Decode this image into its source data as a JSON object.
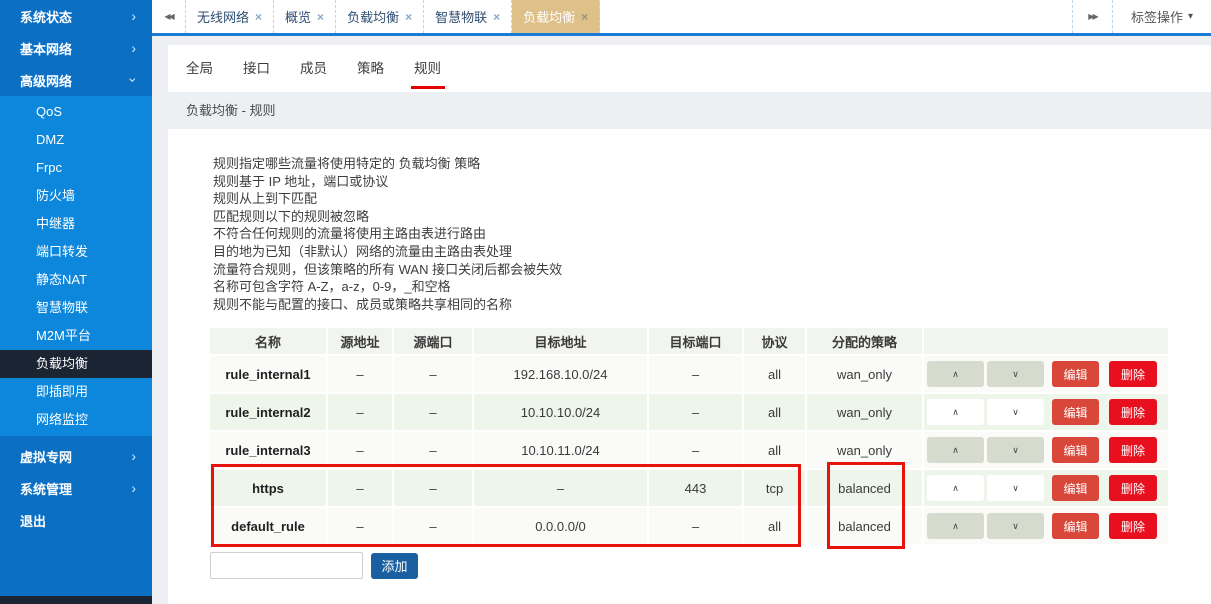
{
  "sidebar": {
    "top_items": [
      {
        "label": "系统状态",
        "expanded": false
      },
      {
        "label": "基本网络",
        "expanded": false
      },
      {
        "label": "高级网络",
        "expanded": true
      }
    ],
    "sub_items": [
      "QoS",
      "DMZ",
      "Frpc",
      "防火墙",
      "中继器",
      "端口转发",
      "静态NAT",
      "智慧物联",
      "M2M平台",
      "负载均衡",
      "即插即用",
      "网络监控"
    ],
    "selected_sub": "负载均衡",
    "bottom_items": [
      {
        "label": "虚拟专网",
        "chevron": true
      },
      {
        "label": "系统管理",
        "chevron": true
      },
      {
        "label": "退出",
        "chevron": false
      }
    ]
  },
  "tabbar": {
    "scroll_left_icon": "◀◀",
    "scroll_right_icon": "▶▶",
    "close_icon": "×",
    "tabs": [
      {
        "label": "无线网络",
        "active": false
      },
      {
        "label": "概览",
        "active": false
      },
      {
        "label": "负载均衡",
        "active": false
      },
      {
        "label": "智慧物联",
        "active": false
      },
      {
        "label": "负载均衡",
        "active": true
      }
    ],
    "tab_ops_label": "标签操作"
  },
  "subtabs": {
    "items": [
      "全局",
      "接口",
      "成员",
      "策略",
      "规则"
    ],
    "active": "规则"
  },
  "breadcrumb": "负载均衡 - 规则",
  "description_lines": [
    "规则指定哪些流量将使用特定的 负载均衡 策略",
    "规则基于 IP 地址，端口或协议",
    "规则从上到下匹配",
    "匹配规则以下的规则被忽略",
    "不符合任何规则的流量将使用主路由表进行路由",
    "目的地为已知（非默认）网络的流量由主路由表处理",
    "流量符合规则，但该策略的所有 WAN 接口关闭后都会被失效",
    "名称可包含字符 A-Z，a-z，0-9，_和空格",
    "规则不能与配置的接口、成员或策略共享相同的名称"
  ],
  "table": {
    "headers": [
      "名称",
      "源地址",
      "源端口",
      "目标地址",
      "目标端口",
      "协议",
      "分配的策略"
    ],
    "rows": [
      {
        "name": "rule_internal1",
        "src_addr": "–",
        "src_port": "–",
        "dst_addr": "192.168.10.0/24",
        "dst_port": "–",
        "proto": "all",
        "policy": "wan_only",
        "highlighted": false
      },
      {
        "name": "rule_internal2",
        "src_addr": "–",
        "src_port": "–",
        "dst_addr": "10.10.10.0/24",
        "dst_port": "–",
        "proto": "all",
        "policy": "wan_only",
        "highlighted": false
      },
      {
        "name": "rule_internal3",
        "src_addr": "–",
        "src_port": "–",
        "dst_addr": "10.10.11.0/24",
        "dst_port": "–",
        "proto": "all",
        "policy": "wan_only",
        "highlighted": false
      },
      {
        "name": "https",
        "src_addr": "–",
        "src_port": "–",
        "dst_addr": "–",
        "dst_port": "443",
        "proto": "tcp",
        "policy": "balanced",
        "highlighted": true
      },
      {
        "name": "default_rule",
        "src_addr": "–",
        "src_port": "–",
        "dst_addr": "0.0.0.0/0",
        "dst_port": "–",
        "proto": "all",
        "policy": "balanced",
        "highlighted": true
      }
    ],
    "up_label": "∧",
    "down_label": "∨",
    "edit_label": "编辑",
    "delete_label": "删除"
  },
  "add_row": {
    "input_value": "",
    "button_label": "添加"
  },
  "colors": {
    "sidebar_top": "#0b70c4",
    "sidebar_submenu": "#0d87dc",
    "sidebar_selected": "#1a2433",
    "active_tab_bg": "#dec089",
    "tabbar_underline": "#1b7ad6",
    "subtab_underline": "#e60000",
    "edit_button": "#d8473a",
    "delete_button": "#e8101e",
    "add_button": "#1a5f9f",
    "row_tint": "#eef5ea",
    "highlight_border": "#e8130b"
  }
}
